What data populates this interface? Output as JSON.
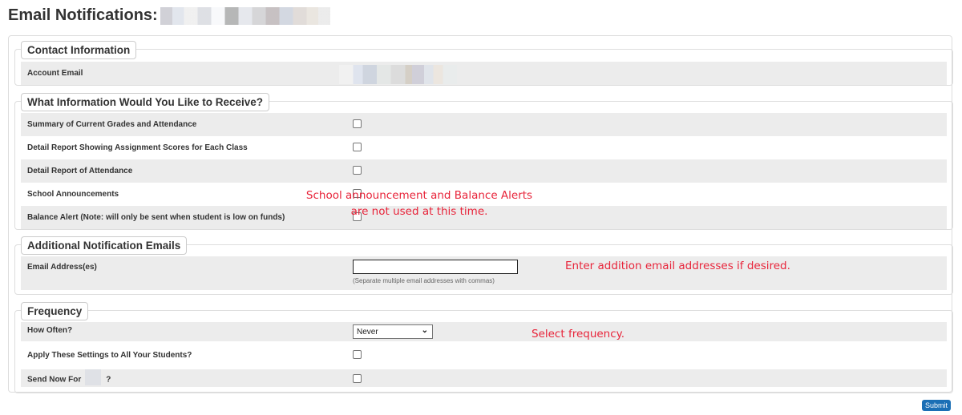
{
  "header": {
    "title": "Email Notifications:"
  },
  "sections": {
    "contact": {
      "legend": "Contact Information",
      "account_email_label": "Account Email"
    },
    "receive": {
      "legend": "What Information Would You Like to Receive?",
      "items": [
        {
          "label": "Summary of Current Grades and Attendance",
          "checked": false
        },
        {
          "label": "Detail Report Showing Assignment Scores for Each Class",
          "checked": false
        },
        {
          "label": "Detail Report of Attendance",
          "checked": false
        },
        {
          "label": "School Announcements",
          "checked": false
        },
        {
          "label": "Balance Alert (Note: will only be sent when student is low on funds)",
          "checked": false
        }
      ],
      "annotation_line1": "School announcement and Balance Alerts",
      "annotation_line2": "are not used at this time."
    },
    "additional": {
      "legend": "Additional Notification Emails",
      "email_label": "Email Address(es)",
      "email_value": "",
      "email_hint": "(Separate multiple email addresses with commas)",
      "annotation": "Enter addition email addresses if desired."
    },
    "frequency": {
      "legend": "Frequency",
      "how_often_label": "How Often?",
      "how_often_value": "Never",
      "apply_all_label": "Apply These Settings to All Your Students?",
      "send_now_label": "Send Now For",
      "send_now_suffix": "?",
      "annotation": "Select frequency."
    }
  },
  "actions": {
    "submit_label": "Submit"
  },
  "colors": {
    "annotation": "#e8243a",
    "submit": "#1b6fb5",
    "row_shade": "#ececec"
  }
}
